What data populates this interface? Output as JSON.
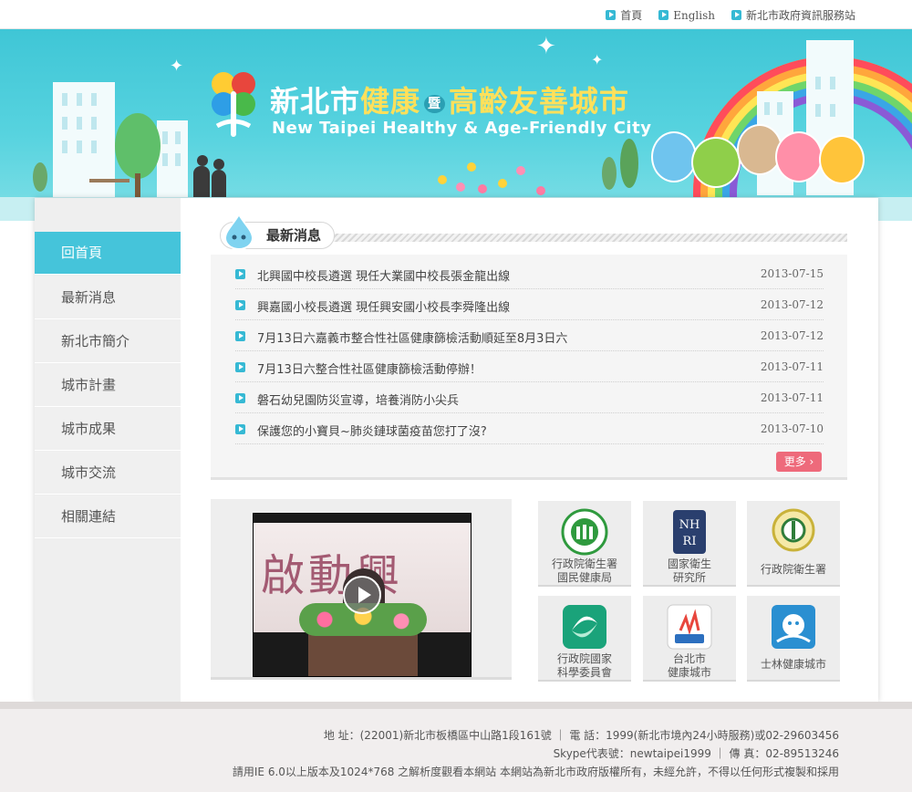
{
  "top_links": [
    {
      "label": "首頁"
    },
    {
      "label": "English"
    },
    {
      "label": "新北市政府資訊服務站"
    }
  ],
  "banner": {
    "title_part1": "新北市",
    "title_part2": "健康",
    "title_join": "暨",
    "title_part3": "高齡友善城市",
    "subtitle": "New Taipei Healthy & Age-Friendly City"
  },
  "sidebar": {
    "items": [
      {
        "label": "回首頁",
        "active": true
      },
      {
        "label": "最新消息"
      },
      {
        "label": "新北市簡介"
      },
      {
        "label": "城市計畫"
      },
      {
        "label": "城市成果"
      },
      {
        "label": "城市交流"
      },
      {
        "label": "相關連結"
      }
    ]
  },
  "news": {
    "heading": "最新消息",
    "more_label": "更多 ›",
    "items": [
      {
        "title": "北興國中校長遴選 現任大業國中校長張金龍出線",
        "date": "2013-07-15"
      },
      {
        "title": "興嘉國小校長遴選 現任興安國小校長李舜隆出線",
        "date": "2013-07-12"
      },
      {
        "title": "7月13日六嘉義市整合性社區健康篩檢活動順延至8月3日六",
        "date": "2013-07-12"
      },
      {
        "title": "7月13日六整合性社區健康篩檢活動停辦！",
        "date": "2013-07-11"
      },
      {
        "title": "磐石幼兒園防災宣導，培養消防小尖兵",
        "date": "2013-07-11"
      },
      {
        "title": "保護您的小寶貝~肺炎鏈球菌疫苗您打了沒?",
        "date": "2013-07-10"
      }
    ]
  },
  "video": {
    "caption_chars": "啟動興"
  },
  "partners": [
    {
      "line1": "行政院衛生署",
      "line2": "國民健康局",
      "color": "#2f9a3e"
    },
    {
      "line1": "國家衛生",
      "line2": "研究所",
      "color": "#2a3f6e"
    },
    {
      "line1": "行政院衛生署",
      "line2": "",
      "color": "#c9b23a"
    },
    {
      "line1": "行政院國家",
      "line2": "科學委員會",
      "color": "#1aa37a"
    },
    {
      "line1": "台北市",
      "line2": "健康城市",
      "color": "#2c6fbf"
    },
    {
      "line1": "士林健康城市",
      "line2": "",
      "color": "#2a8fd1"
    }
  ],
  "footer": {
    "address": "地 址：(22001)新北市板橋區中山路1段161號 ｜ 電 話：1999(新北市境內24小時服務)或02-29603456",
    "skype": "Skype代表號：newtaipei1999 ｜ 傳 真：02-89513246",
    "notice": "請用IE 6.0以上版本及1024*768 之解析度觀看本網站 本網站為新北市政府版權所有，未經允許，不得以任何形式複製和採用"
  }
}
